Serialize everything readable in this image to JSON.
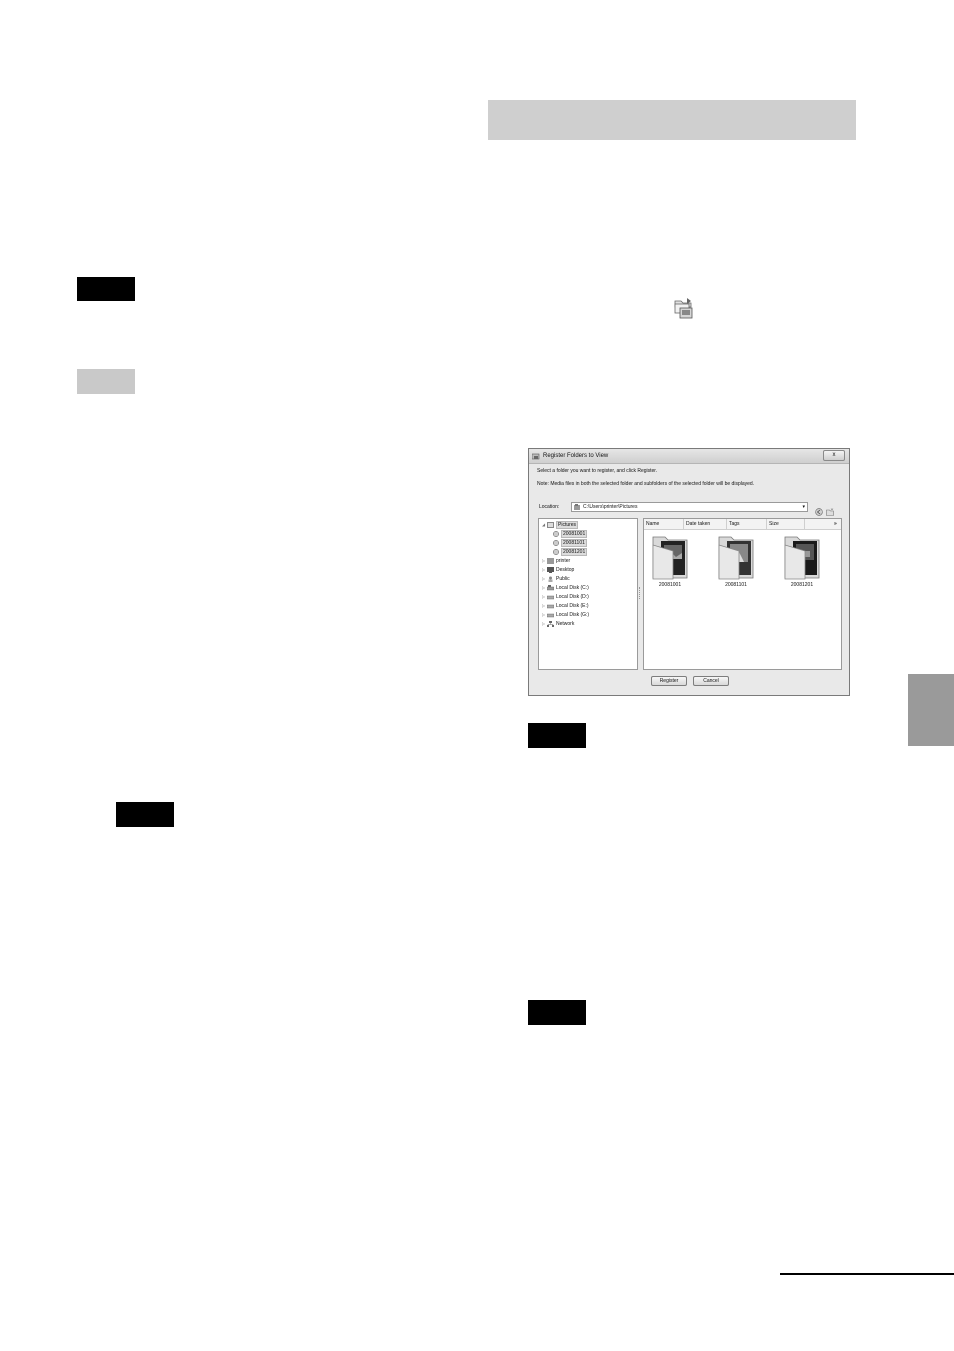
{
  "dialog": {
    "title": "Register Folders to View",
    "close_label": "x",
    "instruction": "Select a folder you want to register, and click Register.",
    "note": "Note: Media files in both the selected folder and subfolders of the selected folder will be displayed.",
    "location_label": "Location:",
    "location_value": "C:\\Users\\printer\\Pictures",
    "tree": [
      {
        "label": "Pictures",
        "selected": true
      },
      {
        "label": "20081001",
        "selected": true
      },
      {
        "label": "20081101",
        "selected": true
      },
      {
        "label": "20081201",
        "selected": true
      },
      {
        "label": "printer",
        "selected": false
      },
      {
        "label": "Desktop",
        "selected": false
      },
      {
        "label": "Public",
        "selected": false
      },
      {
        "label": "Local Disk (C:)",
        "selected": false
      },
      {
        "label": "Local Disk (D:)",
        "selected": false
      },
      {
        "label": "Local Disk (E:)",
        "selected": false
      },
      {
        "label": "Local Disk (G:)",
        "selected": false
      },
      {
        "label": "Network",
        "selected": false
      }
    ],
    "columns": [
      "Name",
      "Date taken",
      "Tags",
      "Size"
    ],
    "more_columns": "»",
    "folders": [
      "20081001",
      "20081101",
      "20081201"
    ],
    "register_label": "Register",
    "cancel_label": "Cancel"
  },
  "icons": {
    "toolbar_icon": "register-folder-icon",
    "close": "close-icon",
    "back": "back-arrow-icon",
    "new_folder": "new-folder-icon"
  },
  "colors": {
    "tag_black": "#000000",
    "tag_grey": "#c9c9c9",
    "header_band": "#cfcfcf",
    "side_tab": "#9a9a9a"
  }
}
